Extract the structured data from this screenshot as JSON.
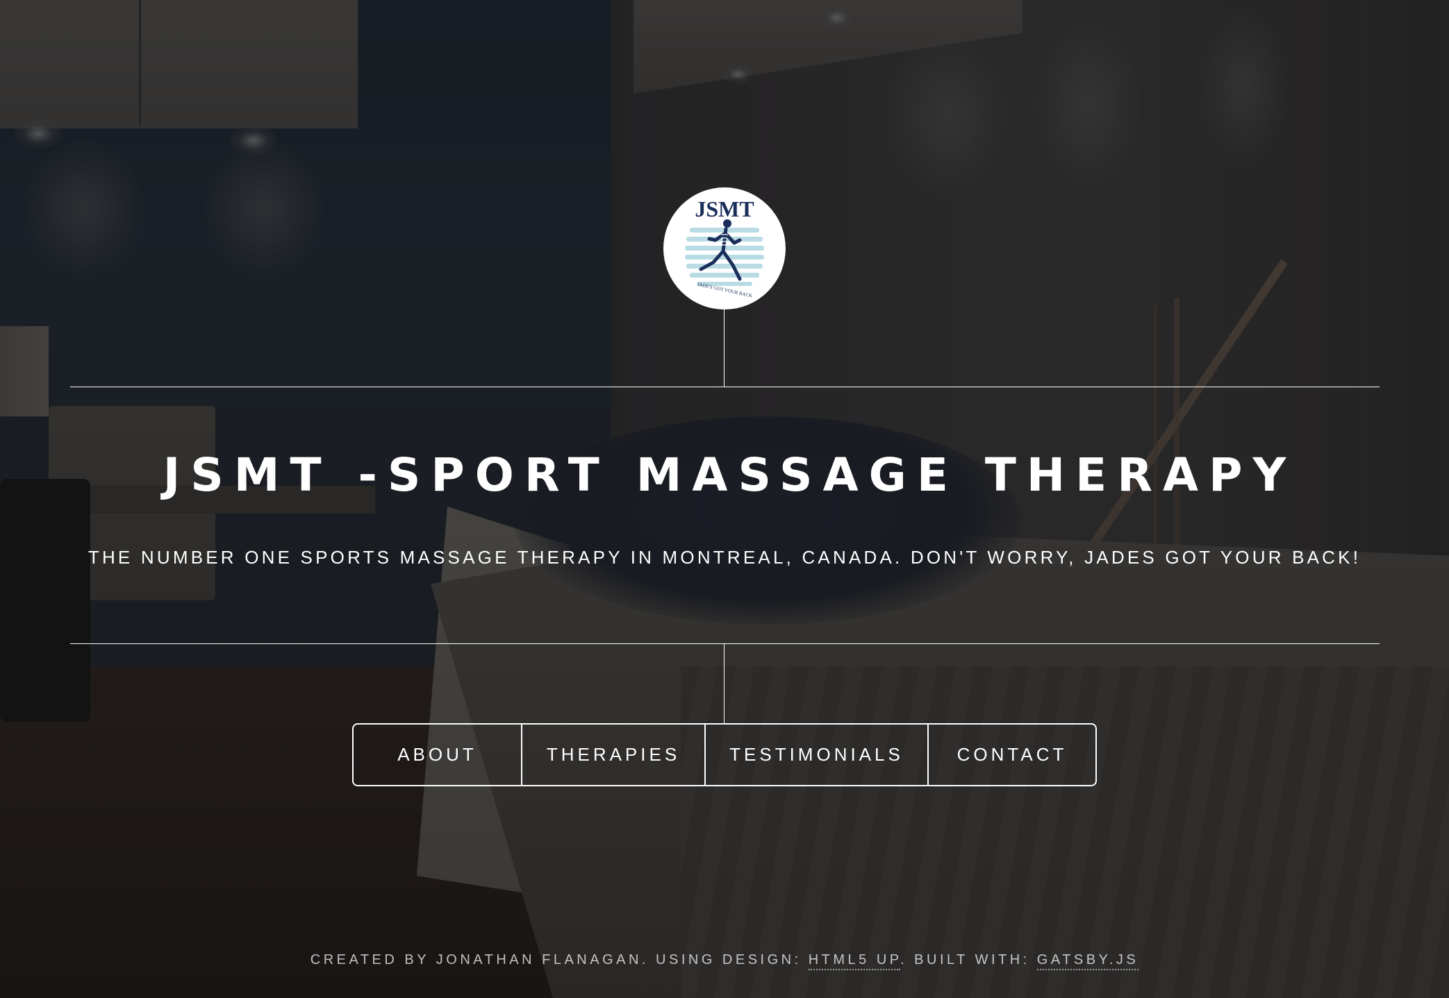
{
  "header": {
    "logo": {
      "text": "JSMT",
      "tagline": "JADE'S GOT YOUR BACK",
      "colors": {
        "navy": "#1a2e5c",
        "stripe": "#b9dbe3",
        "background": "#ffffff"
      }
    },
    "title": "JSMT -Sport Massage Therapy",
    "tagline": "The number one sports massage therapy in Montreal, Canada. Don't worry, Jades got your back!"
  },
  "nav": {
    "items": [
      {
        "label": "About"
      },
      {
        "label": "Therapies"
      },
      {
        "label": "Testimonials"
      },
      {
        "label": "Contact"
      }
    ]
  },
  "footer": {
    "created_by": "Created by Jonathan Flanagan. Using design: ",
    "design_link": "HTML5 UP",
    "built_with": ". Built with: ",
    "gatsby_link": "Gatsby.js"
  },
  "colors": {
    "text": "#ffffff",
    "overlay": "#161618",
    "lines": "#ffffff"
  }
}
